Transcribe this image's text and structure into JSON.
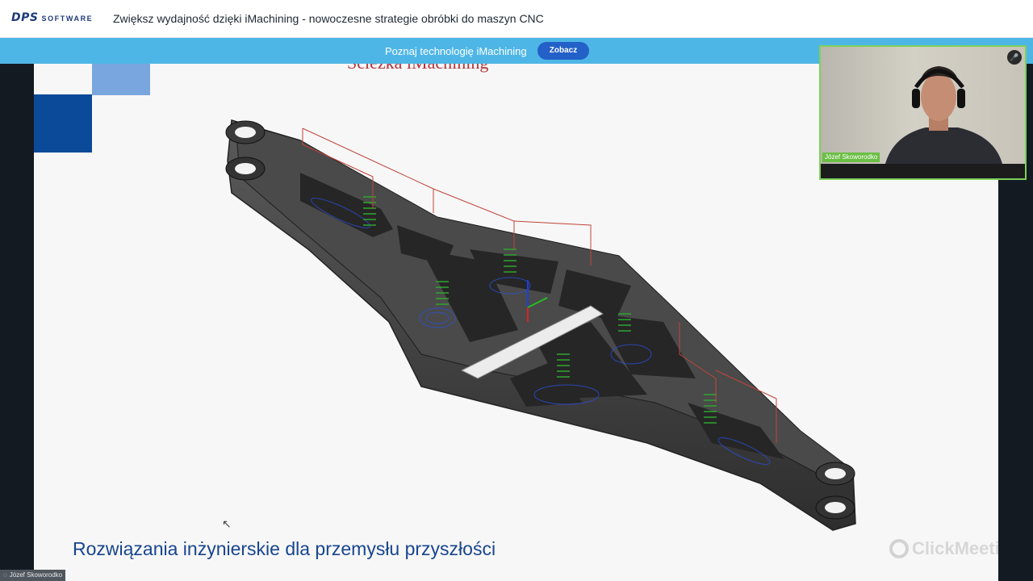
{
  "header": {
    "logo_main": "DPS",
    "logo_sub": "SOFTWARE",
    "title": "Zwiększ wydajność dzięki iMachining - nowoczesne strategie obróbki do maszyn CNC"
  },
  "banner": {
    "text": "Poznaj technologię iMachining",
    "button_label": "Zobacz",
    "color": "#4eb6e6"
  },
  "slide": {
    "title_cut": "Sciezka iMachining",
    "footer": "Rozwiązania inżynierskie dla przemysłu przyszłości",
    "watermark": "ClickMeeting",
    "accent": "#0a4a98"
  },
  "webcam": {
    "name": "Józef Skoworodko",
    "mic_icon": "microphone-icon"
  },
  "speaker_tag": {
    "name": "Józef Skoworodko"
  }
}
